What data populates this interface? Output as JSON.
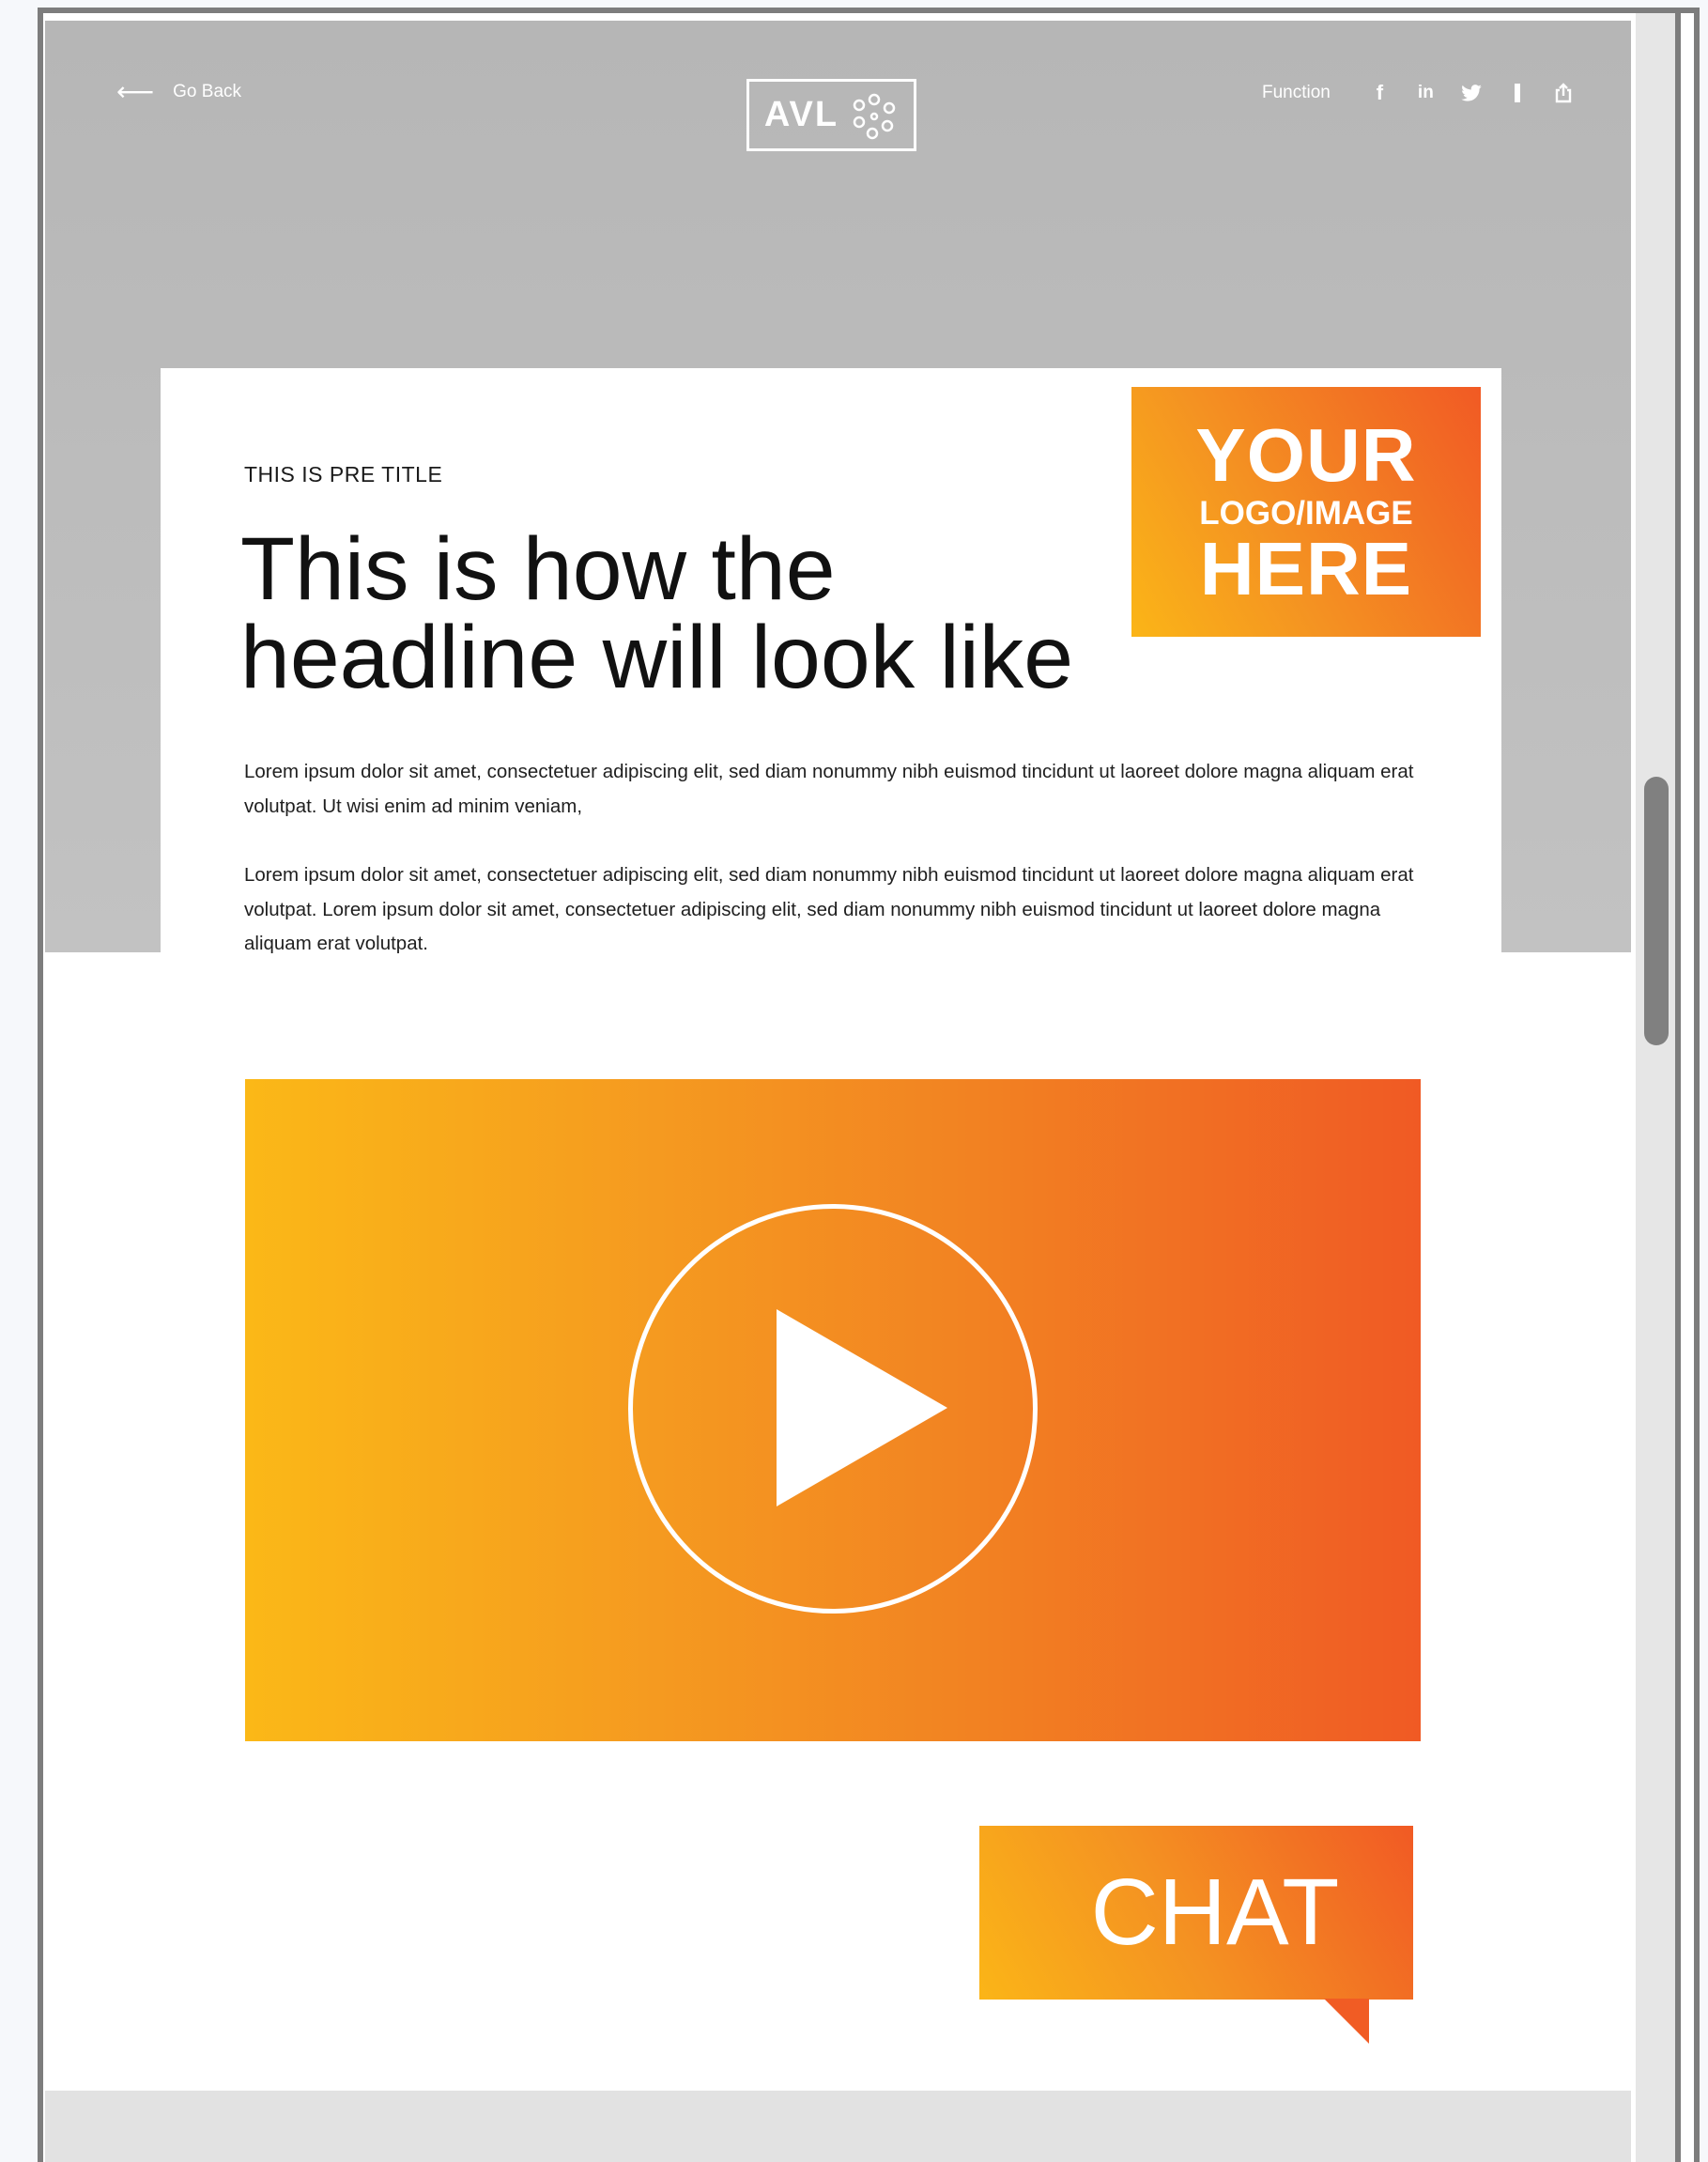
{
  "nav": {
    "back_label": "Go Back",
    "back_icon": "arrow-left-icon",
    "logo_text": "AVL",
    "function_label": "Function",
    "social_icons": [
      "facebook-icon",
      "linkedin-icon",
      "twitter-icon",
      "bookmark-icon",
      "share-icon"
    ]
  },
  "article": {
    "pre_title": "THIS IS PRE TITLE",
    "headline_line1": "This is how the",
    "headline_line2": "headline will look like",
    "paragraph1": "Lorem ipsum dolor sit amet, consectetuer adipiscing elit, sed diam nonummy nibh euismod tincidunt ut laoreet dolore magna aliquam erat volutpat. Ut wisi enim ad minim veniam,",
    "paragraph2": "Lorem ipsum dolor sit amet, consectetuer adipiscing elit, sed diam nonummy nibh euismod tincidunt ut laoreet dolore magna aliquam erat volutpat. Lorem ipsum dolor sit amet, consectetuer adipiscing elit, sed diam nonummy nibh euismod tincidunt ut laoreet dolore magna aliquam erat volutpat."
  },
  "logo_placeholder": {
    "line1": "YOUR",
    "line2": "LOGO/IMAGE",
    "line3": "HERE"
  },
  "video": {
    "play_icon": "play-icon"
  },
  "chat": {
    "label": "CHAT"
  },
  "colors": {
    "accent_start": "#fbb817",
    "accent_end": "#f05a24",
    "hero_gray": "#b9b9b9"
  }
}
